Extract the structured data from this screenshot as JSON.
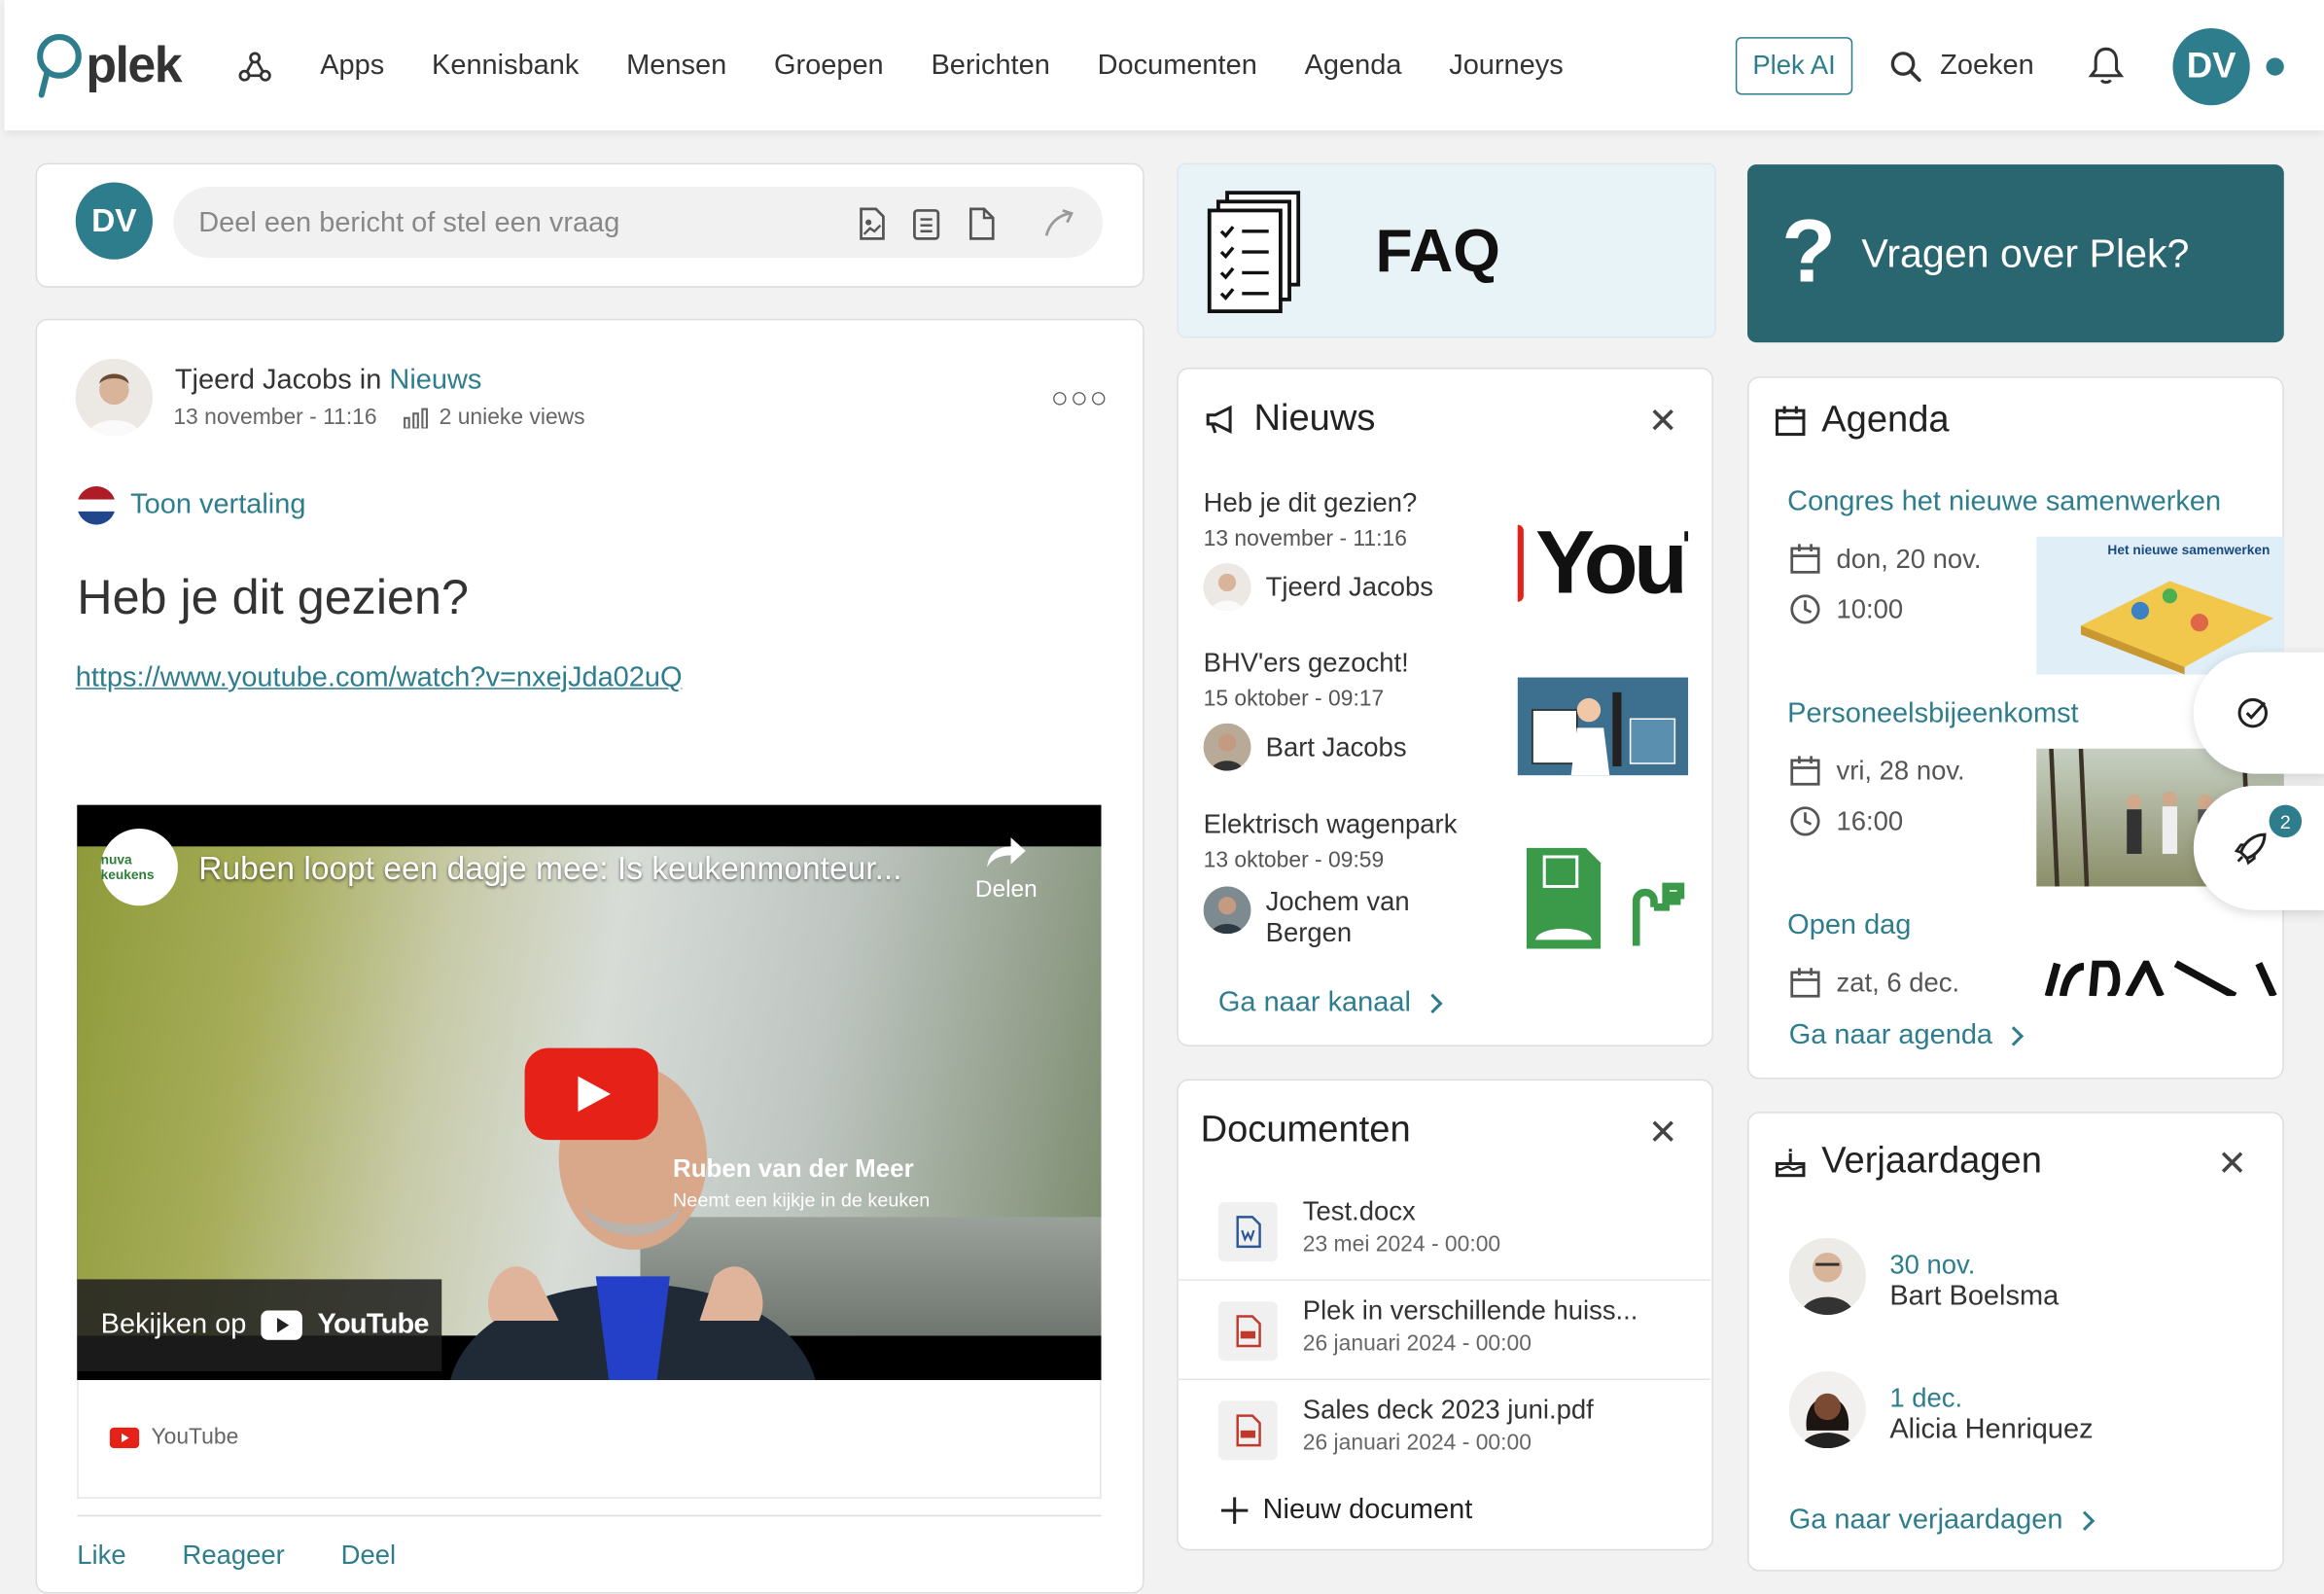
{
  "brand": {
    "logo_text": "plek",
    "accent": "#2e7d8c",
    "accent_dark": "#2a6670"
  },
  "nav": {
    "items": [
      "Apps",
      "Kennisbank",
      "Mensen",
      "Groepen",
      "Berichten",
      "Documenten",
      "Agenda",
      "Journeys"
    ],
    "plek_ai": "Plek AI",
    "search_label": "Zoeken",
    "user_initials": "DV"
  },
  "composer": {
    "initials": "DV",
    "placeholder": "Deel een bericht of stel een vraag"
  },
  "post": {
    "author": "Tjeerd Jacobs",
    "in_word": "in",
    "channel": "Nieuws",
    "date": "13 november - 11:16",
    "views": "2 unieke views",
    "translate": "Toon vertaling",
    "title": "Heb je dit gezien?",
    "link": "https://www.youtube.com/watch?v=nxejJda02uQ",
    "video": {
      "title": "Ruben loopt een dagje mee: Is keukenmonteur...",
      "channel_logo": "nuva keukens",
      "share_label": "Delen",
      "caption_name": "Ruben van der Meer",
      "caption_sub": "Neemt een kijkje in de keuken",
      "watch_on": "Bekijken op",
      "youtube": "YouTube"
    },
    "source": "YouTube",
    "actions": [
      "Like",
      "Reageer",
      "Deel"
    ]
  },
  "faq": {
    "label": "FAQ"
  },
  "vragen": {
    "q": "?",
    "label": "Vragen over Plek?"
  },
  "nieuws": {
    "title": "Nieuws",
    "items": [
      {
        "title": "Heb je dit gezien?",
        "date": "13 november - 11:16",
        "author": "Tjeerd Jacobs",
        "thumb": "YouT"
      },
      {
        "title": "BHV'ers gezocht!",
        "date": "15 oktober - 09:17",
        "author": "Bart Jacobs"
      },
      {
        "title": "Elektrisch wagenpark",
        "date": "13 oktober - 09:59",
        "author_line1": "Jochem van",
        "author_line2": "Bergen"
      }
    ],
    "link": "Ga naar kanaal"
  },
  "documenten": {
    "title": "Documenten",
    "items": [
      {
        "name": "Test.docx",
        "date": "23 mei 2024 - 00:00",
        "type": "word"
      },
      {
        "name": "Plek in verschillende huiss...",
        "date": "26 januari 2024 - 00:00",
        "type": "pdf"
      },
      {
        "name": "Sales deck 2023 juni.pdf",
        "date": "26 januari 2024 - 00:00",
        "type": "pdf"
      }
    ],
    "new": "Nieuw document"
  },
  "agenda": {
    "title": "Agenda",
    "events": [
      {
        "title": "Congres het nieuwe samenwerken",
        "date": "don, 20 nov.",
        "time": "10:00",
        "img_text": "Het nieuwe samenwerken"
      },
      {
        "title": "Personeelsbijeenkomst",
        "date": "vri, 28 nov.",
        "time": "16:00"
      },
      {
        "title": "Open dag",
        "date": "zat, 6 dec."
      }
    ],
    "link": "Ga naar agenda"
  },
  "verjaardagen": {
    "title": "Verjaardagen",
    "items": [
      {
        "date": "30 nov.",
        "name": "Bart Boelsma"
      },
      {
        "date": "1 dec.",
        "name": "Alicia Henriquez"
      }
    ],
    "link": "Ga naar verjaardagen"
  },
  "floating": {
    "badge": "2"
  }
}
